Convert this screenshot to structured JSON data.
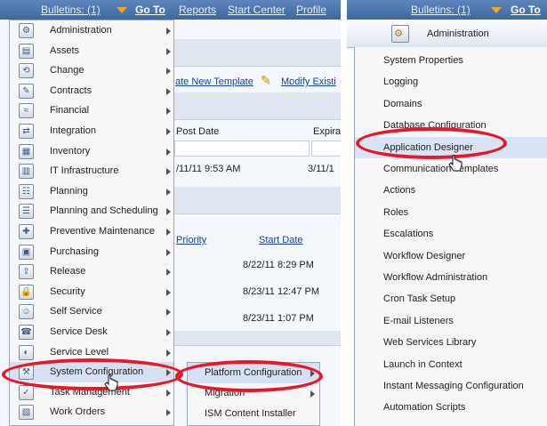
{
  "left": {
    "topbar": {
      "bulletins": "Bulletins: (1)",
      "goto": "Go To",
      "reports": "Reports",
      "start_center": "Start Center",
      "profile": "Profile"
    },
    "background": {
      "create_template": "ate New Template",
      "modify": "Modify Existi",
      "post_date_header": "Post Date",
      "expira_header": "Expira",
      "post_date_value": "/11/11 9:53 AM",
      "expira_value": "3/11/1",
      "priority_header": "Priority",
      "start_date_header": "Start Date",
      "start_dates": [
        "8/22/11 8:29 PM",
        "8/23/11 12:47 PM",
        "8/23/11 1:07 PM"
      ]
    },
    "menu": [
      {
        "label": "Administration",
        "icon": "admin-icon",
        "glyph": "⚙"
      },
      {
        "label": "Assets",
        "icon": "assets-icon",
        "glyph": "▤"
      },
      {
        "label": "Change",
        "icon": "change-icon",
        "glyph": "⟲"
      },
      {
        "label": "Contracts",
        "icon": "contracts-icon",
        "glyph": "✎"
      },
      {
        "label": "Financial",
        "icon": "financial-icon",
        "glyph": "≈"
      },
      {
        "label": "Integration",
        "icon": "integration-icon",
        "glyph": "⇄"
      },
      {
        "label": "Inventory",
        "icon": "inventory-icon",
        "glyph": "▦"
      },
      {
        "label": "IT Infrastructure",
        "icon": "it-infrastructure-icon",
        "glyph": "▥"
      },
      {
        "label": "Planning",
        "icon": "planning-icon",
        "glyph": "☷"
      },
      {
        "label": "Planning and Scheduling",
        "icon": "planning-scheduling-icon",
        "glyph": "☰"
      },
      {
        "label": "Preventive Maintenance",
        "icon": "preventive-maintenance-icon",
        "glyph": "✚"
      },
      {
        "label": "Purchasing",
        "icon": "purchasing-icon",
        "glyph": "▣"
      },
      {
        "label": "Release",
        "icon": "release-icon",
        "glyph": "⇪"
      },
      {
        "label": "Security",
        "icon": "security-icon",
        "glyph": "🔒"
      },
      {
        "label": "Self Service",
        "icon": "self-service-icon",
        "glyph": "☺"
      },
      {
        "label": "Service Desk",
        "icon": "service-desk-icon",
        "glyph": "☎"
      },
      {
        "label": "Service Level",
        "icon": "service-level-icon",
        "glyph": "◐"
      },
      {
        "label": "System Configuration",
        "icon": "system-configuration-icon",
        "glyph": "⚒"
      },
      {
        "label": "Task Management",
        "icon": "task-management-icon",
        "glyph": "✓"
      },
      {
        "label": "Work Orders",
        "icon": "work-orders-icon",
        "glyph": "▧"
      }
    ],
    "submenu": [
      {
        "label": "Platform Configuration",
        "has_arrow": true
      },
      {
        "label": "Migration",
        "has_arrow": true
      },
      {
        "label": "ISM Content Installer",
        "has_arrow": false
      }
    ]
  },
  "right": {
    "topbar": {
      "bulletins": "Bulletins: (1)",
      "goto": "Go To"
    },
    "header_label": "Administration",
    "menu": [
      "System Properties",
      "Logging",
      "Domains",
      "Database Configuration",
      "Application Designer",
      "Communication Templates",
      "Actions",
      "Roles",
      "Escalations",
      "Workflow Designer",
      "Workflow Administration",
      "Cron Task Setup",
      "E-mail Listeners",
      "Web Services Library",
      "Launch in Context",
      "Instant Messaging Configuration",
      "Automation Scripts"
    ]
  },
  "colors": {
    "topbar": "#4a74ab",
    "highlight_ellipse": "#e8182a",
    "goto_arrow": "#f3a626"
  }
}
